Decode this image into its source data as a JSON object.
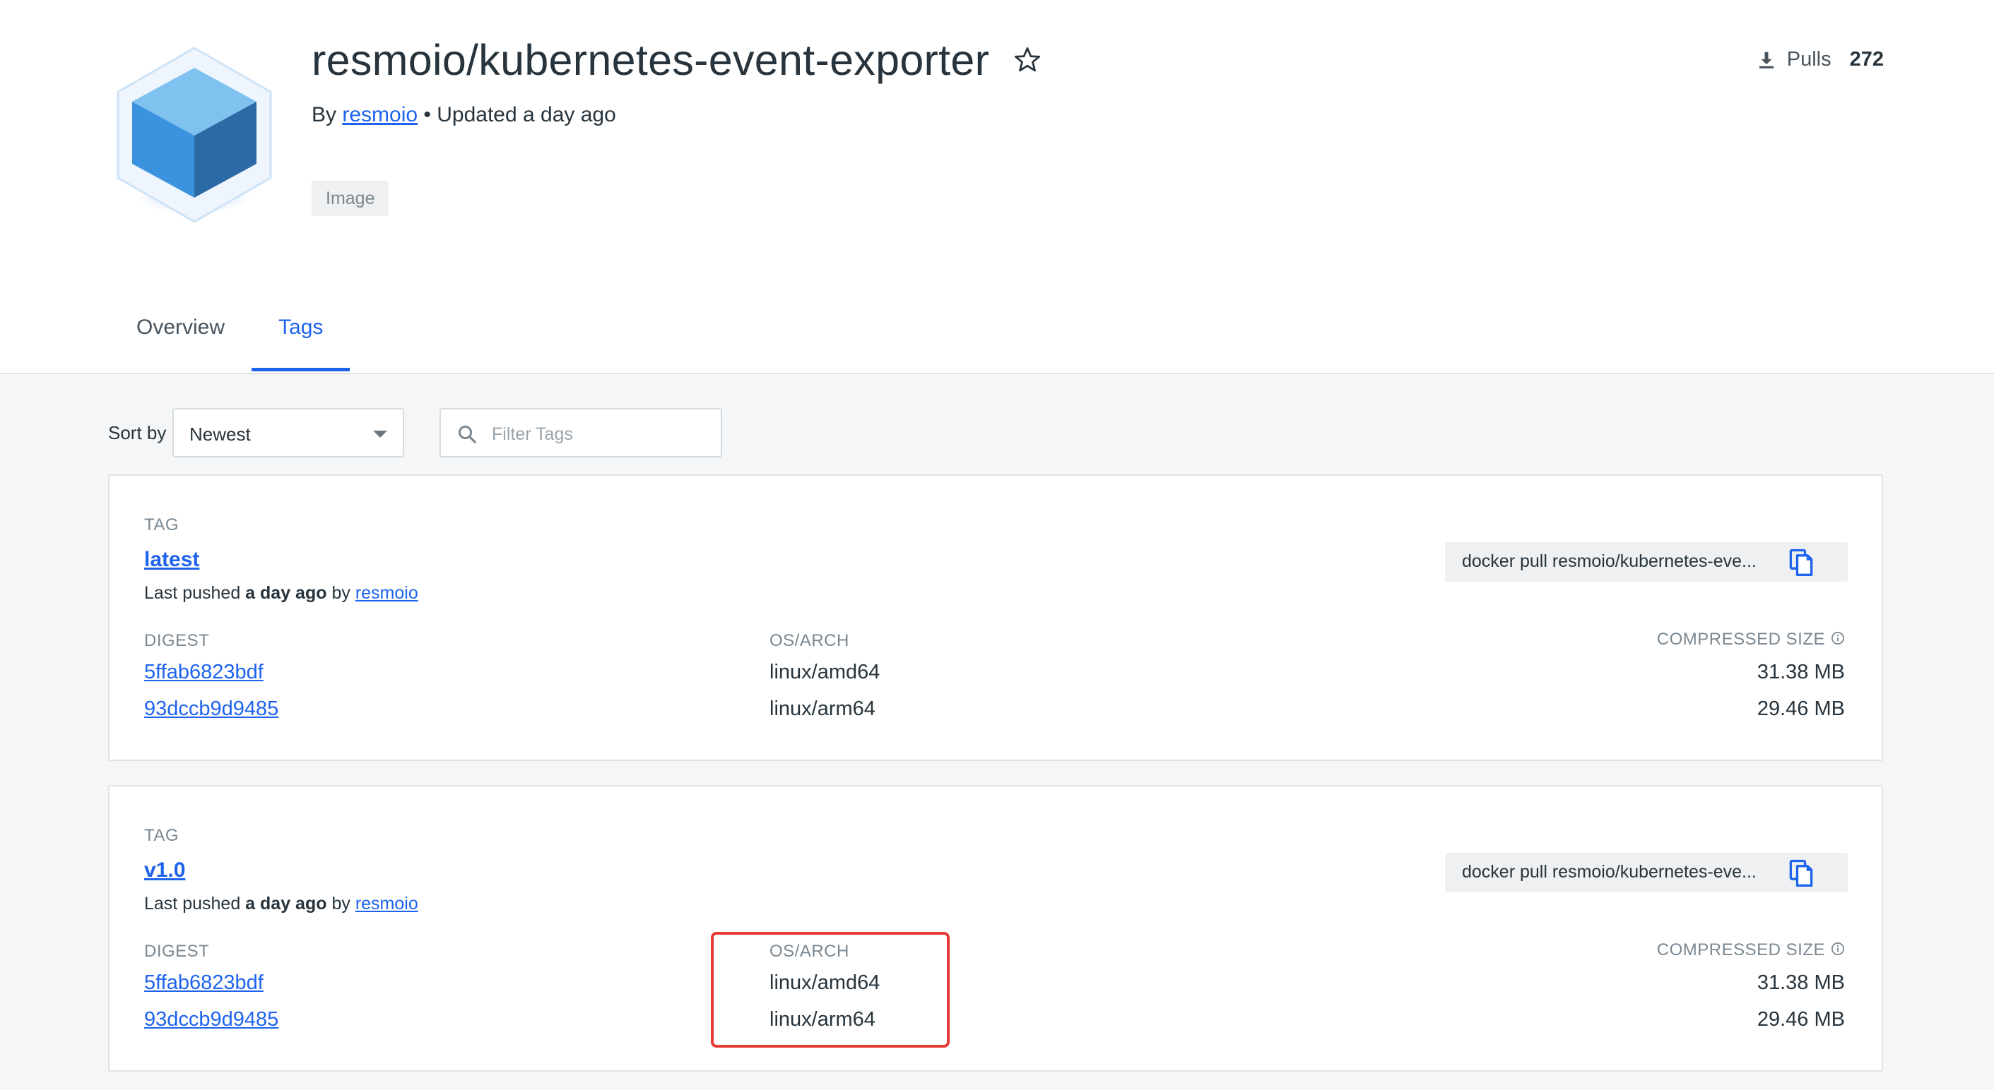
{
  "header": {
    "repo_title": "resmoio/kubernetes-event-exporter",
    "by_prefix": "By",
    "author": "resmoio",
    "updated": "• Updated a day ago",
    "type_badge": "Image",
    "pulls_label": "Pulls",
    "pulls_count": "272",
    "icons": [
      "cube-logo",
      "star-icon",
      "download-icon"
    ]
  },
  "tabs": [
    {
      "label": "Overview",
      "active": false
    },
    {
      "label": "Tags",
      "active": true
    }
  ],
  "toolbar": {
    "sort_label": "Sort by",
    "sort_value": "Newest",
    "filter_placeholder": "Filter Tags"
  },
  "columns": {
    "tag": "TAG",
    "digest": "DIGEST",
    "os_arch": "OS/ARCH",
    "compressed_size": "COMPRESSED SIZE"
  },
  "tags": [
    {
      "name": "latest",
      "pushed_prefix": "Last pushed",
      "pushed_time": "a day ago",
      "pushed_by_prefix": "by",
      "pushed_by": "resmoio",
      "pull_command": "docker pull resmoio/kubernetes-eve...",
      "images": [
        {
          "digest": "5ffab6823bdf",
          "os_arch": "linux/amd64",
          "size": "31.38 MB"
        },
        {
          "digest": "93dccb9d9485",
          "os_arch": "linux/arm64",
          "size": "29.46 MB"
        }
      ]
    },
    {
      "name": "v1.0",
      "pushed_prefix": "Last pushed",
      "pushed_time": "a day ago",
      "pushed_by_prefix": "by",
      "pushed_by": "resmoio",
      "pull_command": "docker pull resmoio/kubernetes-eve...",
      "images": [
        {
          "digest": "5ffab6823bdf",
          "os_arch": "linux/amd64",
          "size": "31.38 MB"
        },
        {
          "digest": "93dccb9d9485",
          "os_arch": "linux/arm64",
          "size": "29.46 MB"
        }
      ]
    }
  ],
  "colors": {
    "accent": "#1d63ed",
    "highlight": "#e53935",
    "background": "#f5f6f7"
  }
}
